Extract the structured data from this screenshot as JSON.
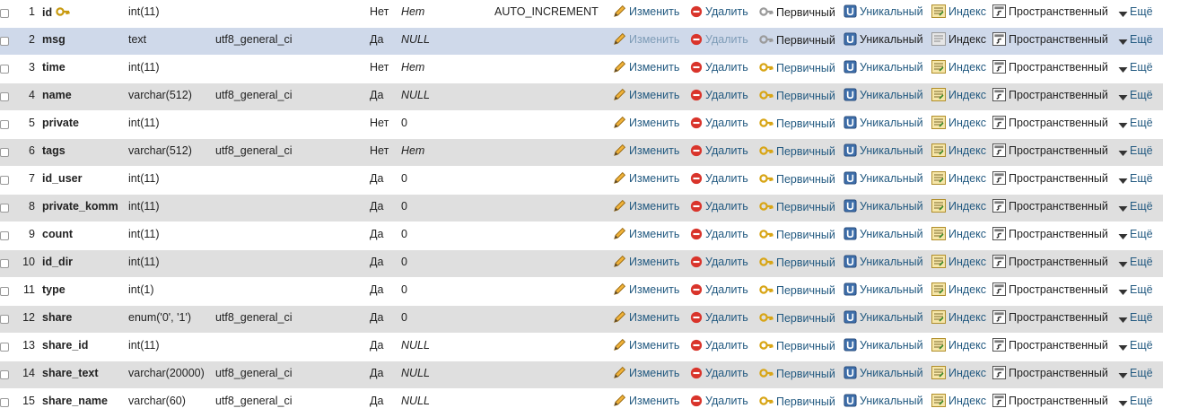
{
  "actions": {
    "edit": "Изменить",
    "delete": "Удалить",
    "primary": "Первичный",
    "unique": "Уникальный",
    "index": "Индекс",
    "spatial": "Пространственный",
    "more": "Ещё"
  },
  "rows": [
    {
      "num": "1",
      "name": "id",
      "type": "int(11)",
      "collation": "",
      "null": "Нет",
      "default": "Нет",
      "default_italic": true,
      "extra": "AUTO_INCREMENT",
      "primary_key": true
    },
    {
      "num": "2",
      "name": "msg",
      "type": "text",
      "collation": "utf8_general_ci",
      "null": "Да",
      "default": "NULL",
      "default_italic": true,
      "extra": "",
      "primary_key": false
    },
    {
      "num": "3",
      "name": "time",
      "type": "int(11)",
      "collation": "",
      "null": "Нет",
      "default": "Нет",
      "default_italic": true,
      "extra": "",
      "primary_key": false
    },
    {
      "num": "4",
      "name": "name",
      "type": "varchar(512)",
      "collation": "utf8_general_ci",
      "null": "Да",
      "default": "NULL",
      "default_italic": true,
      "extra": "",
      "primary_key": false
    },
    {
      "num": "5",
      "name": "private",
      "type": "int(11)",
      "collation": "",
      "null": "Нет",
      "default": "0",
      "default_italic": false,
      "extra": "",
      "primary_key": false
    },
    {
      "num": "6",
      "name": "tags",
      "type": "varchar(512)",
      "collation": "utf8_general_ci",
      "null": "Нет",
      "default": "Нет",
      "default_italic": true,
      "extra": "",
      "primary_key": false
    },
    {
      "num": "7",
      "name": "id_user",
      "type": "int(11)",
      "collation": "",
      "null": "Да",
      "default": "0",
      "default_italic": false,
      "extra": "",
      "primary_key": false
    },
    {
      "num": "8",
      "name": "private_komm",
      "type": "int(11)",
      "collation": "",
      "null": "Да",
      "default": "0",
      "default_italic": false,
      "extra": "",
      "primary_key": false
    },
    {
      "num": "9",
      "name": "count",
      "type": "int(11)",
      "collation": "",
      "null": "Да",
      "default": "0",
      "default_italic": false,
      "extra": "",
      "primary_key": false
    },
    {
      "num": "10",
      "name": "id_dir",
      "type": "int(11)",
      "collation": "",
      "null": "Да",
      "default": "0",
      "default_italic": false,
      "extra": "",
      "primary_key": false
    },
    {
      "num": "11",
      "name": "type",
      "type": "int(1)",
      "collation": "",
      "null": "Да",
      "default": "0",
      "default_italic": false,
      "extra": "",
      "primary_key": false
    },
    {
      "num": "12",
      "name": "share",
      "type": "enum('0', '1')",
      "collation": "utf8_general_ci",
      "null": "Да",
      "default": "0",
      "default_italic": false,
      "extra": "",
      "primary_key": false
    },
    {
      "num": "13",
      "name": "share_id",
      "type": "int(11)",
      "collation": "",
      "null": "Да",
      "default": "NULL",
      "default_italic": true,
      "extra": "",
      "primary_key": false
    },
    {
      "num": "14",
      "name": "share_text",
      "type": "varchar(20000)",
      "collation": "utf8_general_ci",
      "null": "Да",
      "default": "NULL",
      "default_italic": true,
      "extra": "",
      "primary_key": false
    },
    {
      "num": "15",
      "name": "share_name",
      "type": "varchar(60)",
      "collation": "utf8_general_ci",
      "null": "Да",
      "default": "NULL",
      "default_italic": true,
      "extra": "",
      "primary_key": false
    }
  ],
  "highlight_row": 1
}
